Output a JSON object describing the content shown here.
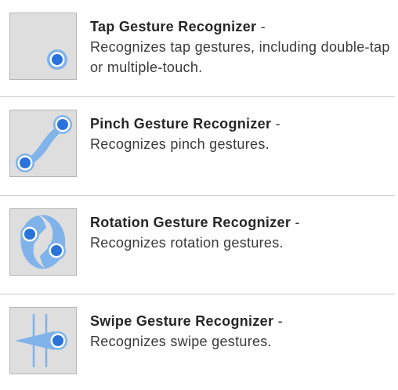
{
  "items": [
    {
      "title": "Tap Gesture Recognizer",
      "dash": "-",
      "description": "Recognizes tap gestures, including double-tap or multiple-touch.",
      "icon": "tap-gesture-icon"
    },
    {
      "title": "Pinch Gesture Recognizer",
      "dash": "-",
      "description": "Recognizes pinch gestures.",
      "icon": "pinch-gesture-icon"
    },
    {
      "title": "Rotation Gesture Recognizer",
      "dash": "-",
      "description": "Recognizes rotation gestures.",
      "icon": "rotation-gesture-icon"
    },
    {
      "title": "Swipe Gesture Recognizer",
      "dash": "-",
      "description": "Recognizes swipe gestures.",
      "icon": "swipe-gesture-icon"
    }
  ],
  "colors": {
    "tile_background": "#dedede",
    "tile_border": "#b7b7b7",
    "accent_light": "#7fb3ea",
    "accent_dark": "#2a73db",
    "divider": "#d0d0d0"
  }
}
